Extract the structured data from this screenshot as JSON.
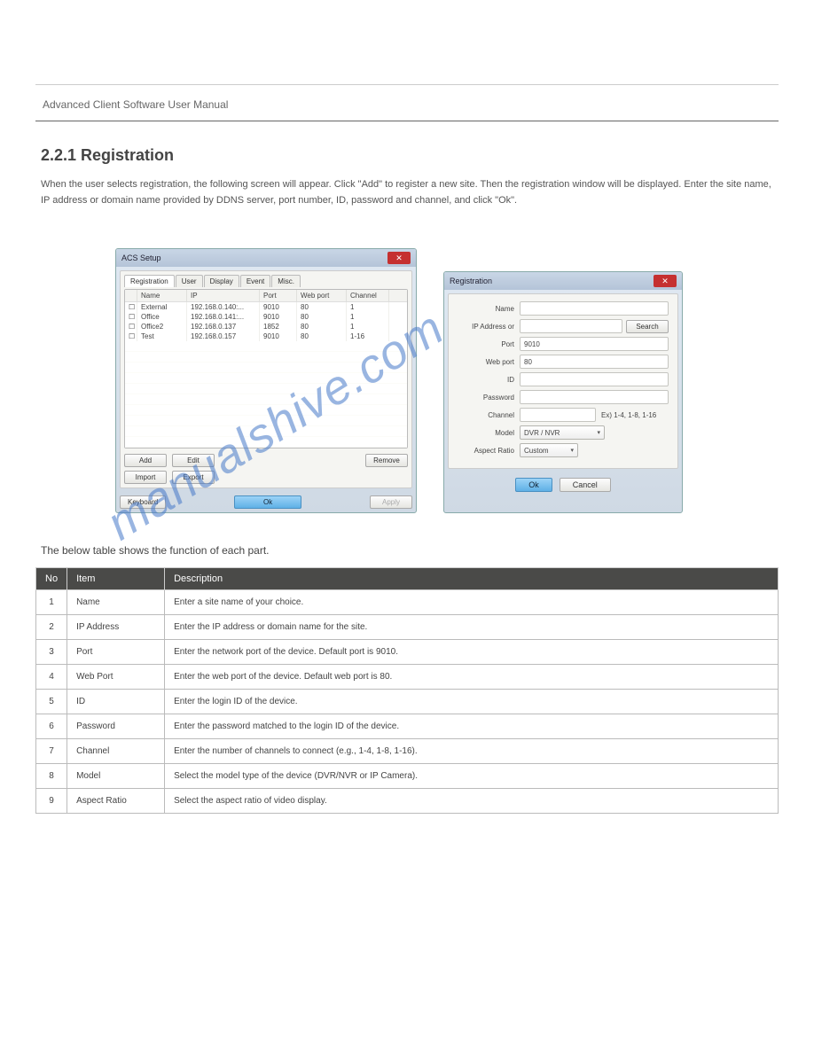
{
  "header": {
    "left": "Advanced Client Software User Manual",
    "right": ""
  },
  "section": {
    "title": "2.2.1  Registration",
    "desc": "When the user selects registration, the following screen will appear. Click \"Add\" to register a new site. Then the registration window will be displayed. Enter the site name, IP address or domain name provided by DDNS server, port number, ID, password and channel, and click \"Ok\"."
  },
  "left_dialog": {
    "title": "ACS Setup",
    "tabs": [
      "Registration",
      "User",
      "Display",
      "Event",
      "Misc."
    ],
    "columns": [
      "",
      "Name",
      "IP",
      "Port",
      "Web port",
      "Channel"
    ],
    "rows": [
      {
        "name": "External",
        "ip": "192.168.0.140:...",
        "port": "9010",
        "web": "80",
        "chan": "1"
      },
      {
        "name": "Office",
        "ip": "192.168.0.141:...",
        "port": "9010",
        "web": "80",
        "chan": "1"
      },
      {
        "name": "Office2",
        "ip": "192.168.0.137",
        "port": "1852",
        "web": "80",
        "chan": "1"
      },
      {
        "name": "Test",
        "ip": "192.168.0.157",
        "port": "9010",
        "web": "80",
        "chan": "1-16"
      }
    ],
    "buttons": {
      "add": "Add",
      "edit": "Edit",
      "remove": "Remove",
      "import": "Import",
      "export": "Export",
      "keyboard": "Keyboard",
      "ok": "Ok",
      "apply": "Apply"
    }
  },
  "right_dialog": {
    "title": "Registration",
    "labels": {
      "name": "Name",
      "ip": "IP Address or",
      "port": "Port",
      "web": "Web port",
      "id": "ID",
      "password": "Password",
      "channel": "Channel",
      "model": "Model",
      "aspect": "Aspect Ratio"
    },
    "values": {
      "port": "9010",
      "web": "80",
      "model": "DVR / NVR",
      "aspect": "Custom"
    },
    "hint": "Ex) 1-4, 1-8, 1-16",
    "buttons": {
      "search": "Search",
      "ok": "Ok",
      "cancel": "Cancel"
    }
  },
  "watermark": "manualshive.com",
  "subtitle": "The below table shows the function of each part.",
  "desc_table": {
    "head": [
      "No",
      "Item",
      "Description"
    ],
    "rows": [
      [
        "1",
        "Name",
        "Enter a site name of your choice."
      ],
      [
        "2",
        "IP Address",
        "Enter the IP address or domain name for the site."
      ],
      [
        "3",
        "Port",
        "Enter the network port of the device. Default port is 9010."
      ],
      [
        "4",
        "Web Port",
        "Enter the web port of the device. Default web port is 80."
      ],
      [
        "5",
        "ID",
        "Enter the login ID of the device."
      ],
      [
        "6",
        "Password",
        "Enter the password matched to the login ID of the device."
      ],
      [
        "7",
        "Channel",
        "Enter the number of channels to connect (e.g., 1-4, 1-8, 1-16)."
      ],
      [
        "8",
        "Model",
        "Select the model type of the device (DVR/NVR or IP Camera)."
      ],
      [
        "9",
        "Aspect Ratio",
        "Select the aspect ratio of video display."
      ]
    ]
  },
  "footer": {
    "left": "",
    "right": ""
  }
}
